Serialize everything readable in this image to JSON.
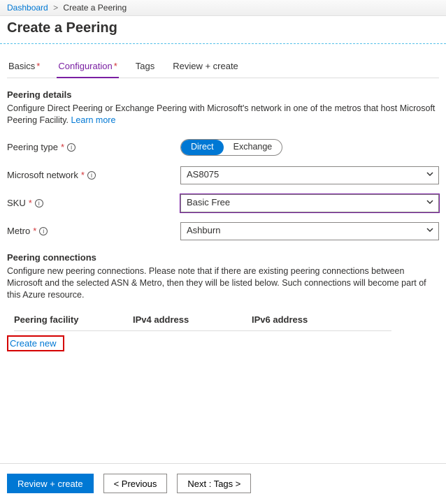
{
  "breadcrumb": {
    "root": "Dashboard",
    "current": "Create a Peering"
  },
  "title": "Create a Peering",
  "tabs": {
    "basics": "Basics",
    "configuration": "Configuration",
    "tags": "Tags",
    "review": "Review + create"
  },
  "details": {
    "heading": "Peering details",
    "desc": "Configure Direct Peering or Exchange Peering with Microsoft's network in one of the metros that host Microsoft Peering Facility. ",
    "learn_more": "Learn more"
  },
  "form": {
    "peering_type_label": "Peering type",
    "peering_type_direct": "Direct",
    "peering_type_exchange": "Exchange",
    "ms_network_label": "Microsoft network",
    "ms_network_value": "AS8075",
    "sku_label": "SKU",
    "sku_value": "Basic Free",
    "metro_label": "Metro",
    "metro_value": "Ashburn"
  },
  "connections": {
    "heading": "Peering connections",
    "desc": "Configure new peering connections. Please note that if there are existing peering connections between Microsoft and the selected ASN & Metro, then they will be listed below. Such connections will become part of this Azure resource.",
    "col_facility": "Peering facility",
    "col_ipv4": "IPv4 address",
    "col_ipv6": "IPv6 address",
    "create_new": "Create new"
  },
  "footer": {
    "review": "Review + create",
    "previous": "< Previous",
    "next": "Next : Tags >"
  }
}
